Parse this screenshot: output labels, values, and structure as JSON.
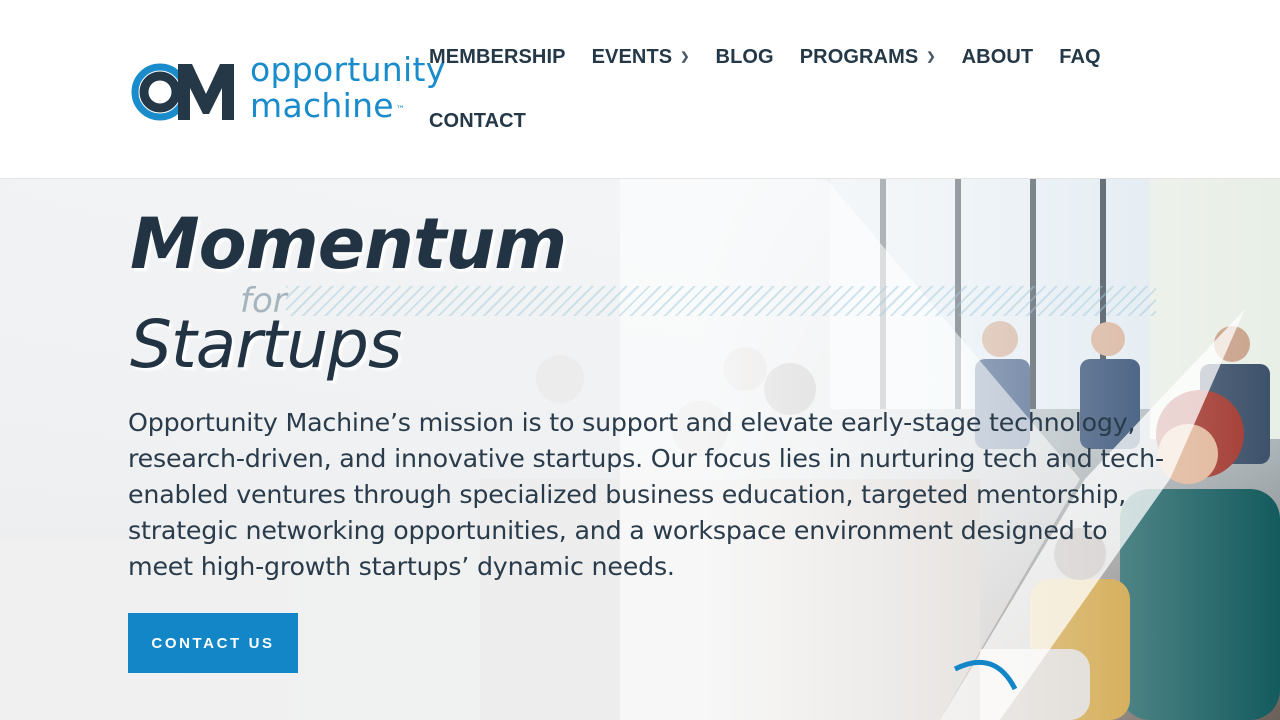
{
  "brand": {
    "name_line1": "opportunity",
    "name_line2": "machine",
    "trademark": "™",
    "colors": {
      "primary_blue": "#1386c8",
      "dark_navy": "#243847"
    }
  },
  "nav": {
    "items": [
      {
        "label": "MEMBERSHIP",
        "has_dropdown": false
      },
      {
        "label": "EVENTS",
        "has_dropdown": true,
        "icon": "chevron-down-icon"
      },
      {
        "label": "BLOG",
        "has_dropdown": false
      },
      {
        "label": "PROGRAMS",
        "has_dropdown": true,
        "icon": "chevron-down-icon"
      },
      {
        "label": "ABOUT",
        "has_dropdown": false
      },
      {
        "label": "FAQ",
        "has_dropdown": false
      },
      {
        "label": "CONTACT",
        "has_dropdown": false
      }
    ]
  },
  "hero": {
    "title_line1": "Momentum",
    "title_connector": "for",
    "title_line2": "Startups",
    "mission": "Opportunity Machine’s mission is to support and elevate early-stage technology, research-driven, and innovative startups. Our focus lies in nurturing tech and tech-enabled ventures through specialized business education, targeted mentorship, strategic networking opportunities, and a workspace environment designed to meet high-growth startups’ dynamic needs.",
    "cta_label": "CONTACT US"
  }
}
